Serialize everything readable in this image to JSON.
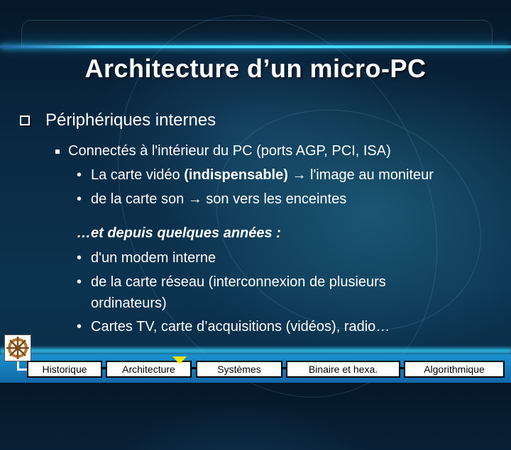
{
  "slide": {
    "title": "Architecture d’un micro-PC",
    "level1": "Périphériques internes",
    "level2": "Connectés à l'intérieur du PC (ports AGP, PCI, ISA)",
    "items_a": [
      {
        "pre": "La carte vidéo ",
        "bold": "(indispensable)",
        "arrow": "→",
        "post": " l'image au moniteur"
      },
      {
        "pre": "de la carte son ",
        "arrow": "→",
        "post": " son vers les enceintes"
      }
    ],
    "italic_heading": "…et depuis quelques années :",
    "items_b": [
      "d'un modem interne",
      "de la carte réseau (interconnexion de plusieurs",
      "Cartes TV, carte d’acquisitions (vidéos), radio…"
    ],
    "items_b_continuation": "ordinateurs)",
    "bullet_glyph": "•"
  },
  "navigation": {
    "logo_icon": "ship-wheel-icon",
    "current": "Architecture",
    "tabs": [
      "Historique",
      "Architecture",
      "Systèmes",
      "Binaire et hexa.",
      "Algorithmique"
    ]
  },
  "colors": {
    "accent_glow": "#3fd4ff",
    "marker": "#f2e600",
    "nav_band": "#1b8fd0"
  }
}
